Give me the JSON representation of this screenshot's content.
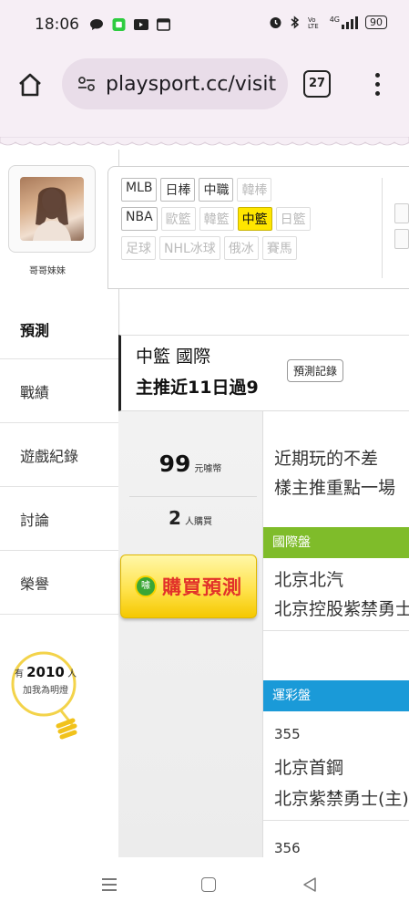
{
  "status": {
    "time": "18:06",
    "network": "4G",
    "battery": "90"
  },
  "browser": {
    "url": "playsport.cc/visit",
    "tab_count": "27"
  },
  "profile": {
    "name": "哥哥妹妹"
  },
  "sidebar": {
    "items": [
      {
        "label": "預測"
      },
      {
        "label": "戰績"
      },
      {
        "label": "遊戲紀錄"
      },
      {
        "label": "討論"
      },
      {
        "label": "榮譽"
      }
    ],
    "light": {
      "prefix": "有",
      "count": "2010",
      "suffix": "人",
      "caption": "加我為明燈"
    }
  },
  "sports": {
    "row1": [
      "MLB",
      "日棒",
      "中職",
      "韓棒"
    ],
    "row2": [
      "NBA",
      "歐籃",
      "韓籃",
      "中籃",
      "日籃"
    ],
    "row3": [
      "足球",
      "NHL冰球",
      "俄冰",
      "賽馬"
    ],
    "selected": "中籃"
  },
  "prediction": {
    "league": "中籃 國際",
    "headline": "主推近11日過9",
    "record_button": "預測記錄",
    "price": "99",
    "price_unit": "元噱幣",
    "buyers": "2",
    "buyers_unit": "人購買",
    "buy_button": "購買預測",
    "buy_badge": "噱",
    "desc_line1": "近期玩的不差",
    "desc_line2": "樣主推重點一場",
    "intl_label": "國際盤",
    "intl_team1": "北京北汽",
    "intl_team2": "北京控股紫禁勇士",
    "lottery_label": "運彩盤",
    "game1_num": "355",
    "game1_team1": "北京首鋼",
    "game1_team2": "北京紫禁勇士(主)",
    "game2_num": "356"
  }
}
